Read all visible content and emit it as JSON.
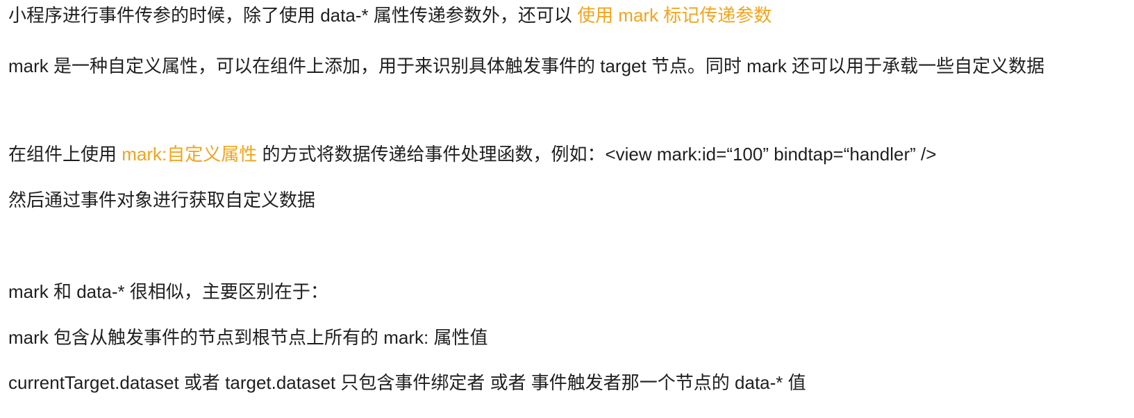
{
  "lines": [
    {
      "before": "小程序进行事件传参的时候，除了使用 data-* 属性传递参数外，还可以 ",
      "highlight": "使用 mark 标记传递参数",
      "after": ""
    },
    {
      "text": "mark 是一种自定义属性，可以在组件上添加，用于来识别具体触发事件的 target 节点。同时 mark 还可以用于承载一些自定义数据"
    },
    {
      "before": "在组件上使用 ",
      "highlight": "mark:自定义属性",
      "after": " 的方式将数据传递给事件处理函数，例如：<view mark:id=“100” bindtap=“handler” />"
    },
    {
      "text": "然后通过事件对象进行获取自定义数据"
    },
    {
      "text": "mark 和 data-* 很相似，主要区别在于："
    },
    {
      "text": "mark 包含从触发事件的节点到根节点上所有的 mark: 属性值"
    },
    {
      "text": "currentTarget.dataset 或者 target.dataset 只包含事件绑定者 或者 事件触发者那一个节点的 data-* 值"
    }
  ],
  "colors": {
    "text": "#1f1f1f",
    "highlight": "#f2a41c",
    "background": "#ffffff"
  }
}
